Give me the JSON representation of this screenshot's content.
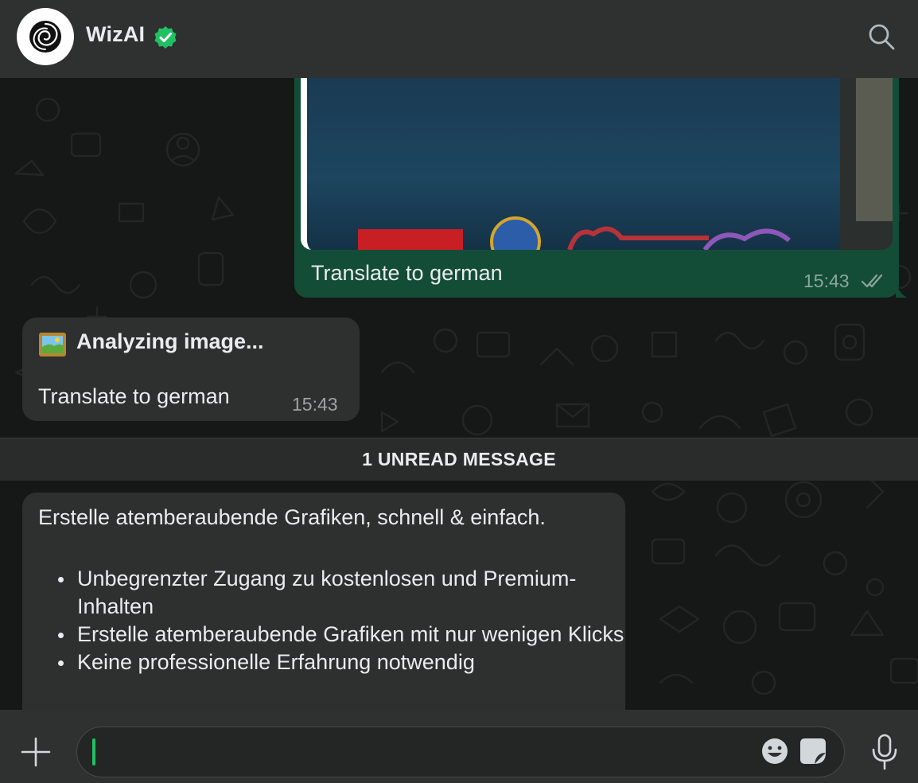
{
  "header": {
    "contact_name": "WizAI",
    "avatar_icon": "wizai-logo-icon",
    "verified_icon": "verified-badge-icon",
    "search_icon": "search-icon"
  },
  "messages": {
    "outgoing_image": {
      "caption": "Translate to german",
      "time": "15:43",
      "status_icon": "double-check-icon"
    },
    "analyzing": {
      "emoji": "framed-picture-emoji",
      "title": "Analyzing image...",
      "caption": "Translate to german",
      "time": "15:43"
    },
    "unread_divider": "1 UNREAD MESSAGE",
    "reply": {
      "intro": "Erstelle atemberaubende Grafiken, schnell & einfach.",
      "bullets": [
        "Unbegrenzter Zugang zu kostenlosen und Premium-Inhalten",
        "Erstelle atemberaubende Grafiken mit nur wenigen Klicks",
        "Keine professionelle Erfahrung notwendig"
      ]
    }
  },
  "composer": {
    "value": "",
    "placeholder": "",
    "plus_icon": "plus-icon",
    "emoji_icon": "emoji-icon",
    "sticker_icon": "sticker-icon",
    "mic_icon": "microphone-icon"
  },
  "colors": {
    "outgoing_bubble": "#144d37",
    "incoming_bubble": "#2e2f2f",
    "accent": "#21c063"
  }
}
